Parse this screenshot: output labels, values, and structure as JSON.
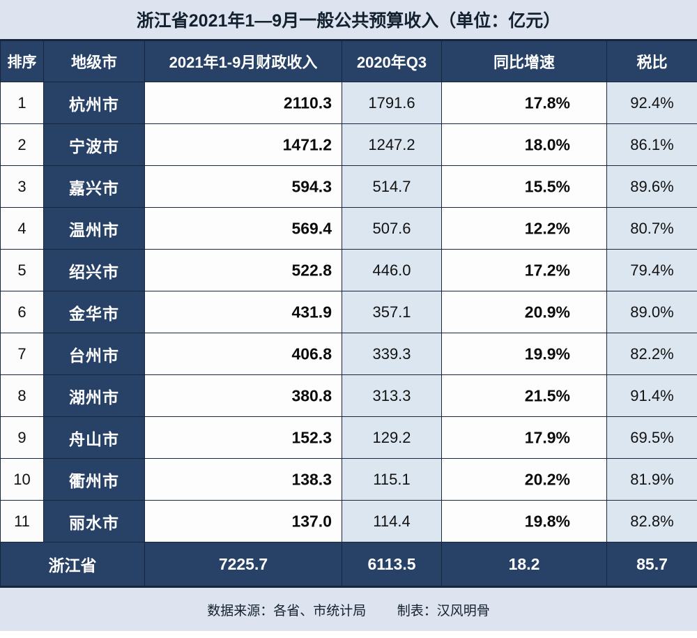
{
  "title": "浙江省2021年1—9月一般公共预算收入（单位：亿元）",
  "colors": {
    "navy": "#274167",
    "orange": "#fbb82c",
    "light_blue": "#dce6f0",
    "title_bg": "#dde4ef"
  },
  "watermark": "汉风明骨",
  "columns": {
    "rank": "排序",
    "city": "地级市",
    "revenue": "2021年1-9月财政收入",
    "previous": "2020年Q3",
    "growth": "同比增速",
    "tax": "税比"
  },
  "chart_data": {
    "type": "table",
    "title": "浙江省2021年1—9月一般公共预算收入（单位：亿元）",
    "categories": [
      "杭州市",
      "宁波市",
      "嘉兴市",
      "温州市",
      "绍兴市",
      "金华市",
      "台州市",
      "湖州市",
      "舟山市",
      "衢州市",
      "丽水市"
    ],
    "series": [
      {
        "name": "2021年1-9月财政收入",
        "values": [
          2110.3,
          1471.2,
          594.3,
          569.4,
          522.8,
          431.9,
          406.8,
          380.8,
          152.3,
          138.3,
          137.0
        ]
      },
      {
        "name": "2020年Q3",
        "values": [
          1791.6,
          1247.2,
          514.7,
          507.6,
          446.0,
          357.1,
          339.3,
          313.3,
          129.2,
          115.1,
          114.4
        ]
      },
      {
        "name": "同比增速",
        "values": [
          17.8,
          18.0,
          15.5,
          12.2,
          17.2,
          20.9,
          19.9,
          21.5,
          17.9,
          20.2,
          19.8
        ]
      },
      {
        "name": "税比",
        "values": [
          92.4,
          86.1,
          89.6,
          80.7,
          79.4,
          89.0,
          82.2,
          91.4,
          69.5,
          81.9,
          82.8
        ]
      }
    ],
    "revenue_max": 2110.3,
    "growth_max": 21.5,
    "xlabel": "",
    "ylabel": "亿元",
    "grid": false,
    "legend": "none"
  },
  "rows": [
    {
      "rank": "1",
      "city": "杭州市",
      "revenue": "2110.3",
      "revenue_val": 2110.3,
      "previous": "1791.6",
      "growth": "17.8%",
      "growth_val": 17.8,
      "tax": "92.4%"
    },
    {
      "rank": "2",
      "city": "宁波市",
      "revenue": "1471.2",
      "revenue_val": 1471.2,
      "previous": "1247.2",
      "growth": "18.0%",
      "growth_val": 18.0,
      "tax": "86.1%"
    },
    {
      "rank": "3",
      "city": "嘉兴市",
      "revenue": "594.3",
      "revenue_val": 594.3,
      "previous": "514.7",
      "growth": "15.5%",
      "growth_val": 15.5,
      "tax": "89.6%"
    },
    {
      "rank": "4",
      "city": "温州市",
      "revenue": "569.4",
      "revenue_val": 569.4,
      "previous": "507.6",
      "growth": "12.2%",
      "growth_val": 12.2,
      "tax": "80.7%"
    },
    {
      "rank": "5",
      "city": "绍兴市",
      "revenue": "522.8",
      "revenue_val": 522.8,
      "previous": "446.0",
      "growth": "17.2%",
      "growth_val": 17.2,
      "tax": "79.4%"
    },
    {
      "rank": "6",
      "city": "金华市",
      "revenue": "431.9",
      "revenue_val": 431.9,
      "previous": "357.1",
      "growth": "20.9%",
      "growth_val": 20.9,
      "tax": "89.0%"
    },
    {
      "rank": "7",
      "city": "台州市",
      "revenue": "406.8",
      "revenue_val": 406.8,
      "previous": "339.3",
      "growth": "19.9%",
      "growth_val": 19.9,
      "tax": "82.2%"
    },
    {
      "rank": "8",
      "city": "湖州市",
      "revenue": "380.8",
      "revenue_val": 380.8,
      "previous": "313.3",
      "growth": "21.5%",
      "growth_val": 21.5,
      "tax": "91.4%"
    },
    {
      "rank": "9",
      "city": "舟山市",
      "revenue": "152.3",
      "revenue_val": 152.3,
      "previous": "129.2",
      "growth": "17.9%",
      "growth_val": 17.9,
      "tax": "69.5%"
    },
    {
      "rank": "10",
      "city": "衢州市",
      "revenue": "138.3",
      "revenue_val": 138.3,
      "previous": "115.1",
      "growth": "20.2%",
      "growth_val": 20.2,
      "tax": "81.9%"
    },
    {
      "rank": "11",
      "city": "丽水市",
      "revenue": "137.0",
      "revenue_val": 137.0,
      "previous": "114.4",
      "growth": "19.8%",
      "growth_val": 19.8,
      "tax": "82.8%"
    }
  ],
  "summary": {
    "label": "浙江省",
    "revenue": "7225.7",
    "previous": "6113.5",
    "growth": "18.2",
    "tax": "85.7"
  },
  "footer": {
    "source": "数据来源：各省、市统计局",
    "author": "制表：汉风明骨"
  }
}
